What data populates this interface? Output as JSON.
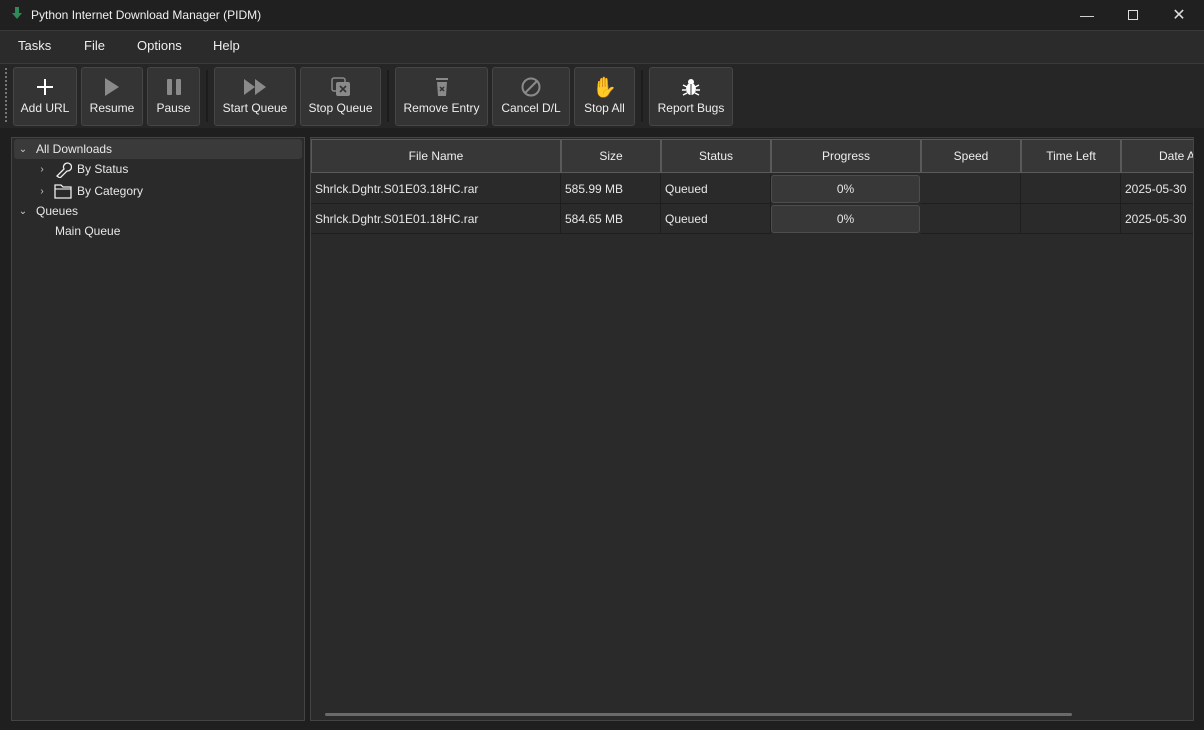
{
  "window": {
    "title": "Python Internet Download Manager (PIDM)",
    "controls": [
      "minimize-icon",
      "maximize-icon",
      "close-icon"
    ]
  },
  "menu": [
    "Tasks",
    "File",
    "Options",
    "Help"
  ],
  "toolbar": [
    {
      "label": "Add URL",
      "icon": "plus-icon"
    },
    {
      "label": "Resume",
      "icon": "play-icon"
    },
    {
      "label": "Pause",
      "icon": "pause-icon"
    },
    {
      "label": "Start Queue",
      "icon": "fast-forward-icon"
    },
    {
      "label": "Stop Queue",
      "icon": "stop-queue-icon"
    },
    {
      "label": "Remove Entry",
      "icon": "trash-icon"
    },
    {
      "label": "Cancel D/L",
      "icon": "cancel-icon"
    },
    {
      "label": "Stop All",
      "icon": "hand-icon"
    },
    {
      "label": "Report Bugs",
      "icon": "bug-icon"
    }
  ],
  "tree": {
    "all": "All Downloads",
    "by_status": "By Status",
    "by_category": "By Category",
    "queues": "Queues",
    "main_queue": "Main Queue"
  },
  "table": {
    "headers": [
      "File Name",
      "Size",
      "Status",
      "Progress",
      "Speed",
      "Time Left",
      "Date A"
    ],
    "rows": [
      {
        "name": "Shrlck.Dghtr.S01E03.18HC.rar",
        "size": "585.99 MB",
        "status": "Queued",
        "progress": "0%",
        "progress_value": 0,
        "speed": "",
        "time_left": "",
        "date": "2025-05-30"
      },
      {
        "name": "Shrlck.Dghtr.S01E01.18HC.rar",
        "size": "584.65 MB",
        "status": "Queued",
        "progress": "0%",
        "progress_value": 0,
        "speed": "",
        "time_left": "",
        "date": "2025-05-30"
      }
    ]
  }
}
